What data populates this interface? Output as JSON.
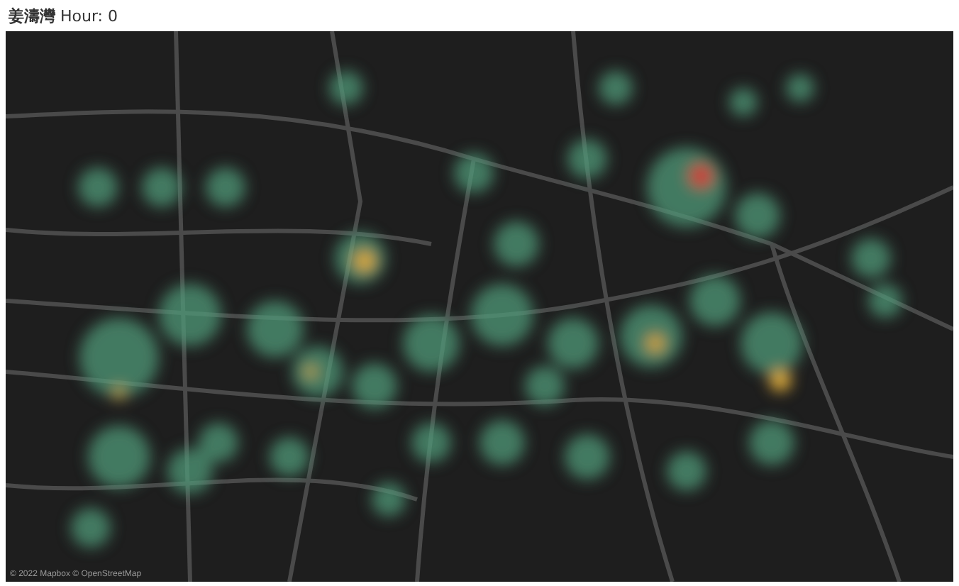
{
  "title": "**姜濤灣** Hour: 0",
  "map": {
    "attribution": "© 2022 Mapbox © OpenStreetMap"
  }
}
